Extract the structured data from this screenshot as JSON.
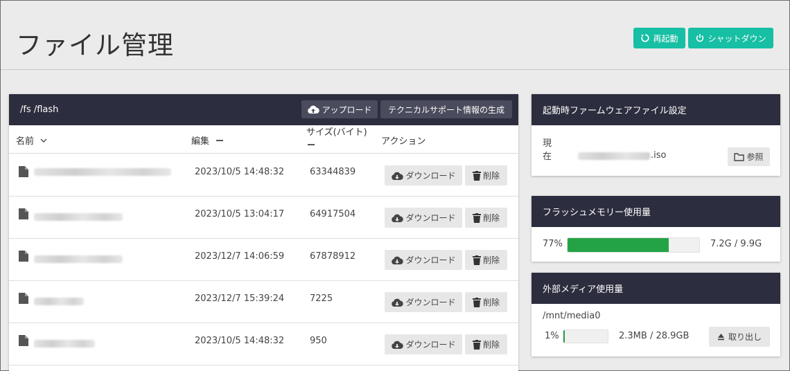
{
  "header": {
    "title": "ファイル管理",
    "restart_label": "再起動",
    "shutdown_label": "シャットダウン"
  },
  "file_panel": {
    "path": "/fs /flash",
    "upload_label": "アップロード",
    "support_label": "テクニカルサポート情報の生成",
    "columns": {
      "name": "名前",
      "edit": "編集",
      "size": "サイズ(バイト)",
      "action": "アクション"
    },
    "download_label": "ダウンロード",
    "delete_label": "削除",
    "rows": [
      {
        "date": "2023/10/5 14:48:32",
        "size": "63344839"
      },
      {
        "date": "2023/10/5 13:04:17",
        "size": "64917504"
      },
      {
        "date": "2023/12/7 14:06:59",
        "size": "67878912"
      },
      {
        "date": "2023/12/7 15:39:24",
        "size": "7225"
      },
      {
        "date": "2023/10/5 14:48:32",
        "size": "950"
      }
    ]
  },
  "boot_firmware": {
    "title": "起動時ファームウェアファイル設定",
    "current_label": "現在",
    "file_ext": ".iso",
    "browse_label": "参照"
  },
  "flash_usage": {
    "title": "フラッシュメモリー使用量",
    "percent_text": "77%",
    "percent": 77,
    "usage_text": "7.2G / 9.9G"
  },
  "media_usage": {
    "title": "外部メディア使用量",
    "mount_path": "/mnt/media0",
    "percent_text": "1%",
    "percent": 1,
    "usage_text": "2.3MB / 28.9GB",
    "eject_label": "取り出し"
  },
  "colors": {
    "accent": "#17bfa4",
    "panel_header": "#2c2d3e",
    "progress": "#24a346"
  }
}
